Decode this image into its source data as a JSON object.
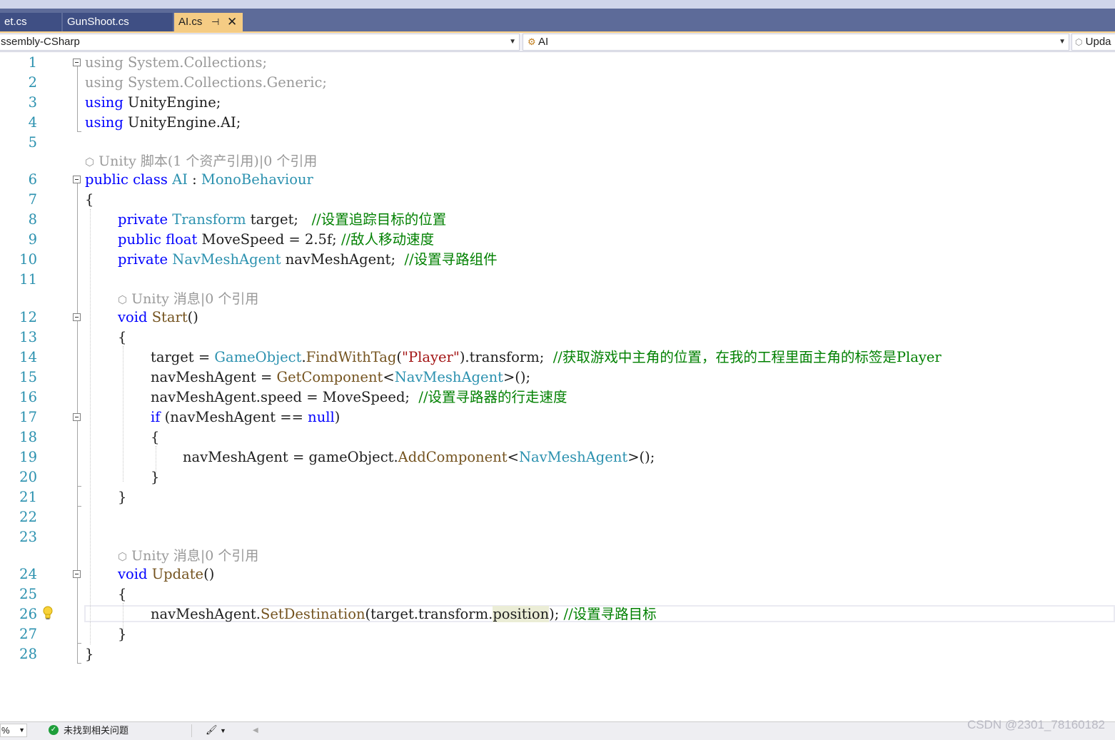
{
  "tabs": [
    {
      "label": "et.cs"
    },
    {
      "label": "GunShoot.cs"
    },
    {
      "label": "AI.cs",
      "pin": "⊣",
      "close": "✕"
    }
  ],
  "nav": {
    "project": "ssembly-CSharp",
    "class": "AI",
    "member": "Upda"
  },
  "line_numbers": [
    "1",
    "2",
    "3",
    "4",
    "5",
    "6",
    "7",
    "8",
    "9",
    "10",
    "11",
    "12",
    "13",
    "14",
    "15",
    "16",
    "17",
    "18",
    "19",
    "20",
    "21",
    "22",
    "23",
    "24",
    "25",
    "26",
    "27",
    "28"
  ],
  "lens": {
    "class_lens": "Unity 脚本(1 个资产引用)|0 个引用",
    "start_lens": "Unity 消息|0 个引用",
    "update_lens": "Unity 消息|0 个引用"
  },
  "code": {
    "l1": [
      "using",
      " System.Collections;"
    ],
    "l2": [
      "using",
      " System.Collections.Generic;"
    ],
    "l3": [
      "using",
      " UnityEngine;"
    ],
    "l4": [
      "using",
      " UnityEngine.AI;"
    ],
    "l6": [
      "public",
      " ",
      "class",
      " ",
      "AI",
      " : ",
      "MonoBehaviour"
    ],
    "l7": "{",
    "l8": [
      "private",
      " ",
      "Transform",
      " target;   ",
      "//设置追踪目标的位置"
    ],
    "l9": [
      "public",
      " ",
      "float",
      " MoveSpeed = 2.5f; ",
      "//敌人移动速度"
    ],
    "l10": [
      "private",
      " ",
      "NavMeshAgent",
      " navMeshAgent;  ",
      "//设置寻路组件"
    ],
    "l12": [
      "void",
      " ",
      "Start",
      "()"
    ],
    "l13": "{",
    "l14": [
      "target = ",
      "GameObject",
      ".",
      "FindWithTag",
      "(",
      "\"Player\"",
      ").transform;  ",
      "//获取游戏中主角的位置，在我的工程里面主角的标签是Player"
    ],
    "l15": [
      "navMeshAgent = ",
      "GetComponent",
      "<",
      "NavMeshAgent",
      ">();"
    ],
    "l16": [
      "navMeshAgent.speed = MoveSpeed;  ",
      "//设置寻路器的行走速度"
    ],
    "l17": [
      "if",
      " (navMeshAgent ",
      "==",
      " ",
      "null",
      ")"
    ],
    "l18": "{",
    "l19": [
      "navMeshAgent = gameObject.",
      "AddComponent",
      "<",
      "NavMeshAgent",
      ">();"
    ],
    "l20": "}",
    "l21": "}",
    "l24": [
      "void",
      " ",
      "Update",
      "()"
    ],
    "l25": "{",
    "l26": [
      "navMeshAgent.",
      "SetDestination",
      "(target.transform.",
      "position",
      "); ",
      "//设置寻路目标"
    ],
    "l27": "}",
    "l28": "}"
  },
  "status": {
    "zoom": "%",
    "issues": "未找到相关问题"
  },
  "watermark": "CSDN @2301_78160182",
  "colors": {
    "keyword": "#0000ff",
    "type": "#2b91af",
    "comment": "#008000",
    "string": "#a31515",
    "method": "#74531f",
    "tab_active": "#f5cc84",
    "tab_bar": "#5d6b99"
  }
}
